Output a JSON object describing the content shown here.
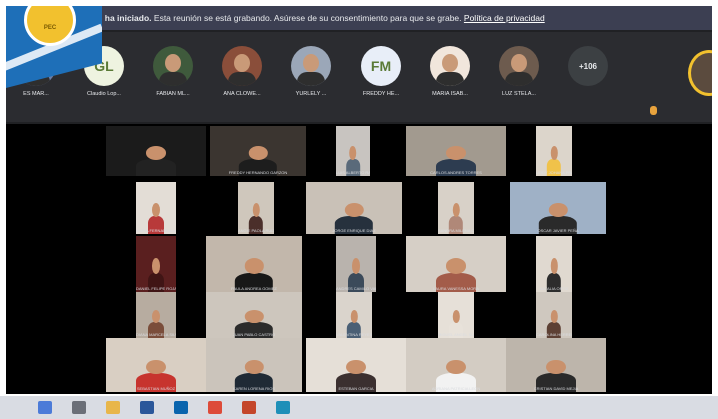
{
  "banner": {
    "bold_text": "Se ha iniciado.",
    "text": "Esta reunión se está grabando. Asúrese de su consentimiento para que se grabe.",
    "link": "Política de privacidad"
  },
  "logo": {
    "seal_text": "PEC"
  },
  "participants": [
    {
      "name": "ES MAR...",
      "initials": "",
      "color": "#6b7ea8"
    },
    {
      "name": "Claudio Lop...",
      "initials": "GL",
      "color": "#eef3e0"
    },
    {
      "name": "FABIAN ML...",
      "initials": "",
      "color": "#3f5a3c"
    },
    {
      "name": "ANA CLOWE...",
      "initials": "",
      "color": "#8a4e3a"
    },
    {
      "name": "YURLELY ...",
      "initials": "",
      "color": "#9ba7b8"
    },
    {
      "name": "FREDDY HE...",
      "initials": "FM",
      "color": "#e8eef8"
    },
    {
      "name": "MARIA ISAB...",
      "initials": "",
      "color": "#f1e6dc"
    },
    {
      "name": "LUZ STELA...",
      "initials": "",
      "color": "#6d5b4e"
    },
    {
      "name": "+106",
      "initials": "+106",
      "color": "#3c4043"
    }
  ],
  "tiles": [
    {
      "color": "#1b1b1b",
      "shirt": "#222",
      "label": ""
    },
    {
      "color": "#3b3530",
      "shirt": "#1d1d1d",
      "label": "FREDDY HERNANDO GARZON"
    },
    {
      "color": "#c8c4c0",
      "shirt": "#5a6a7a",
      "label": "LUIS ALBERTO RAMIREZ"
    },
    {
      "color": "#a29a8f",
      "shirt": "#2d3c50",
      "label": "CARLOS ANDRES TORRES"
    },
    {
      "color": "#dcd5cb",
      "shirt": "#f0c24a",
      "label": "LEIDY JOHANA PRADA"
    },
    {
      "color": "#e3ddd6",
      "shirt": "#b83a3a",
      "label": "MARIA FERNANDA LOPEZ"
    },
    {
      "color": "#cfc7bc",
      "shirt": "#4b2f2a",
      "label": "ANGIE PAOLA RUIZ"
    },
    {
      "color": "#c9c1b7",
      "shirt": "#26313d",
      "label": "JORGE ENRIQUE DIAZ"
    },
    {
      "color": "#d8d1c8",
      "shirt": "#b08878",
      "label": "SANDRA MILENA CRUZ"
    },
    {
      "color": "#9fb1c6",
      "shirt": "#2a2a2a",
      "label": "OSCAR JAVIER PEÑA"
    },
    {
      "color": "#5a1f1f",
      "shirt": "#401515",
      "label": "DANIEL FELIPE ROJAS"
    },
    {
      "color": "#c2b7ab",
      "shirt": "#181818",
      "label": "PAULA ANDREA GOMEZ"
    },
    {
      "color": "#b9b3ad",
      "shirt": "#3b4a5a",
      "label": "ANDRES CAMILO VARGAS"
    },
    {
      "color": "#d6cfc6",
      "shirt": "#a35c4a",
      "label": "LAURA VANESSA MORA"
    },
    {
      "color": "#e0d9d0",
      "shirt": "#2d2d2d",
      "label": "NATALIA ORTIZ"
    },
    {
      "color": "#b7aca0",
      "shirt": "#7a4d3a",
      "label": "DIANA MARCELA SILVA"
    },
    {
      "color": "#cdc6bd",
      "shirt": "#2b2b2b",
      "label": "JUAN PABLO CASTRO"
    },
    {
      "color": "#dad4cc",
      "shirt": "#4a5f75",
      "label": "VALENTINA REYES"
    },
    {
      "color": "#e6e0d8",
      "shirt": "#e8e2da",
      "label": "MIGUEL ANGEL SUAREZ"
    },
    {
      "color": "#cfc8bf",
      "shirt": "#5d4034",
      "label": "CAROLINA HERRERA"
    },
    {
      "color": "#d9cfc3",
      "shirt": "#c7342e",
      "label": "SEBASTIAN MUÑOZ"
    },
    {
      "color": "#cbc4bb",
      "shirt": "#1f2a35",
      "label": "KAREN LORENA RIOS"
    },
    {
      "color": "#e5dfd7",
      "shirt": "#3b3030",
      "label": "ESTEBAN GARCIA"
    },
    {
      "color": "#d3ccc3",
      "shirt": "#f2f2f2",
      "label": "ADRIANA PATRICIA LEON"
    },
    {
      "color": "#bdb5ab",
      "shirt": "#2a2a2a",
      "label": "CRISTIAN DAVID MEJIA"
    }
  ],
  "taskbar": {
    "icons": [
      {
        "name": "windows-start-icon",
        "color": "#4c7bd8"
      },
      {
        "name": "search-icon",
        "color": "#6b6f78"
      },
      {
        "name": "file-explorer-icon",
        "color": "#e8b64a"
      },
      {
        "name": "word-icon",
        "color": "#2b579a"
      },
      {
        "name": "outlook-icon",
        "color": "#0a64ad"
      },
      {
        "name": "chrome-icon",
        "color": "#dd4b39"
      },
      {
        "name": "powerpoint-icon",
        "color": "#c4462a"
      },
      {
        "name": "edge-icon",
        "color": "#1e8fb8"
      }
    ]
  }
}
